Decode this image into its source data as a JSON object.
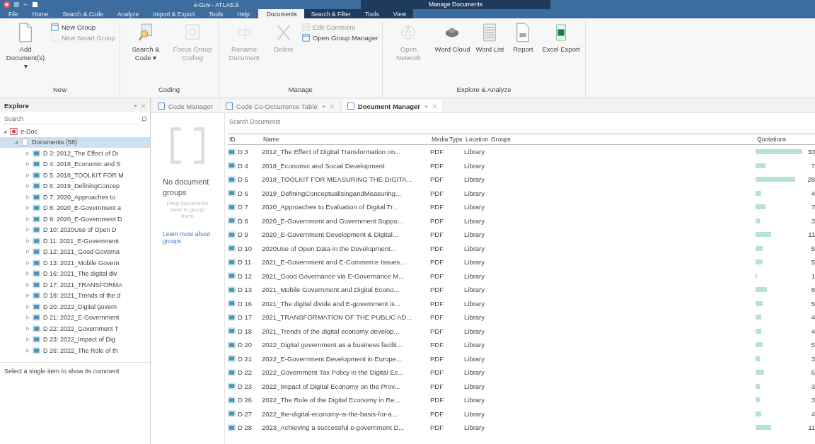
{
  "window": {
    "title": "e-Gov - ATLAS.ti"
  },
  "ribbon": {
    "tabs": [
      {
        "label": "File",
        "selected": false
      },
      {
        "label": "Home",
        "selected": false
      },
      {
        "label": "Search & Code",
        "selected": false
      },
      {
        "label": "Analyze",
        "selected": false
      },
      {
        "label": "Import & Export",
        "selected": false
      },
      {
        "label": "Tools",
        "selected": false
      },
      {
        "label": "Help",
        "selected": false
      }
    ],
    "context": {
      "title": "Manage Documents",
      "tabs": [
        {
          "label": "Documents",
          "selected": true
        },
        {
          "label": "Search & Filter",
          "selected": false
        },
        {
          "label": "Tools",
          "selected": false
        },
        {
          "label": "View",
          "selected": false
        }
      ]
    },
    "groups": [
      {
        "label": "New",
        "items": [
          {
            "kind": "large",
            "label": "Add Document(s) ▾",
            "disabled": false
          },
          {
            "kind": "small",
            "label": "New Group",
            "disabled": false
          },
          {
            "kind": "small",
            "label": "New Smart Group",
            "disabled": true
          }
        ]
      },
      {
        "label": "Coding",
        "items": [
          {
            "kind": "large",
            "label": "Search & Code ▾",
            "disabled": false
          },
          {
            "kind": "large",
            "label": "Focus Group Coding",
            "disabled": true
          }
        ]
      },
      {
        "label": "Manage",
        "items": [
          {
            "kind": "large",
            "label": "Rename Document",
            "disabled": true
          },
          {
            "kind": "large",
            "label": "Delete",
            "disabled": true
          },
          {
            "kind": "small",
            "label": "Edit Comment",
            "disabled": true
          },
          {
            "kind": "small",
            "label": "Open Group Manager",
            "disabled": false
          }
        ]
      },
      {
        "label": "Explore & Analyze",
        "items": [
          {
            "kind": "large",
            "label": "Open Network",
            "disabled": true
          },
          {
            "kind": "large",
            "label": "Word Cloud",
            "disabled": false
          },
          {
            "kind": "large",
            "label": "Word List",
            "disabled": false
          },
          {
            "kind": "large",
            "label": "Report",
            "disabled": false
          },
          {
            "kind": "large",
            "label": "Excel Export",
            "disabled": false
          }
        ]
      }
    ]
  },
  "explorer": {
    "title": "Explore",
    "search": {
      "placeholder": "Search"
    },
    "tree": [
      {
        "label": "e-Doc",
        "expanded": true,
        "selected": false,
        "children": [
          {
            "label": "Documents (58)",
            "expanded": true,
            "selected": true,
            "children": [
              {
                "label": "D 3: 2012_The Effect of Di",
                "expanded": false,
                "selected": false
              },
              {
                "label": "D 4: 2018_Economic and S",
                "expanded": false,
                "selected": false
              },
              {
                "label": "D 5: 2018_TOOLKIT FOR M",
                "expanded": false,
                "selected": false
              },
              {
                "label": "D 6: 2019_DefiningConcep",
                "expanded": false,
                "selected": false
              },
              {
                "label": "D 7: 2020_Approaches to",
                "expanded": false,
                "selected": false
              },
              {
                "label": "D 8: 2020_E-Government a",
                "expanded": false,
                "selected": false
              },
              {
                "label": "D 9: 2020_E-Government D",
                "expanded": false,
                "selected": false
              },
              {
                "label": "D 10: 2020Use of Open D",
                "expanded": false,
                "selected": false
              },
              {
                "label": "D 11: 2021_E-Government",
                "expanded": false,
                "selected": false
              },
              {
                "label": "D 12: 2021_Good Governa",
                "expanded": false,
                "selected": false
              },
              {
                "label": "D 13: 2021_Mobile Govern",
                "expanded": false,
                "selected": false
              },
              {
                "label": "D 16: 2021_The digital div",
                "expanded": false,
                "selected": false
              },
              {
                "label": "D 17: 2021_TRANSFORMA",
                "expanded": false,
                "selected": false
              },
              {
                "label": "D 18: 2021_Trends of the d",
                "expanded": false,
                "selected": false
              },
              {
                "label": "D 20: 2022_Digital govern",
                "expanded": false,
                "selected": false
              },
              {
                "label": "D 21: 2022_E-Government",
                "expanded": false,
                "selected": false
              },
              {
                "label": "D 22: 2022_Government T",
                "expanded": false,
                "selected": false
              },
              {
                "label": "D 23: 2022_Impact of Dig",
                "expanded": false,
                "selected": false
              },
              {
                "label": "D 26: 2022_The Role of th",
                "expanded": false,
                "selected": false
              }
            ]
          }
        ]
      }
    ],
    "comment": "Select a single item to show its comment"
  },
  "panel_tabs": [
    {
      "label": "Code Manager",
      "selected": false,
      "has_controls": false
    },
    {
      "label": "Code Co-Occurrence Table",
      "selected": false,
      "has_controls": true
    },
    {
      "label": "Document Manager",
      "selected": true,
      "has_controls": true
    }
  ],
  "groups_pane": {
    "title": "No document groups",
    "hint": "Drag documents here to group them",
    "link": "Learn more about groups"
  },
  "documents": {
    "search": {
      "placeholder": "Search Documents"
    },
    "columns": [
      "ID",
      "Name",
      "Media Type",
      "Location",
      "Groups",
      "Quotations"
    ],
    "rows": [
      {
        "id": "D 3",
        "name": "2012_The Effect of Digital Transformation on...",
        "media": "PDF",
        "location": "Library",
        "quotations": "33"
      },
      {
        "id": "D 4",
        "name": "2018_Economic and Social Development",
        "media": "PDF",
        "location": "Library",
        "quotations": "7"
      },
      {
        "id": "D 5",
        "name": "2018_TOOLKIT FOR MEASURING THE DIGITA...",
        "media": "PDF",
        "location": "Library",
        "quotations": "28"
      },
      {
        "id": "D 6",
        "name": "2019_DefiningConceptualisingandMeasuring...",
        "media": "PDF",
        "location": "Library",
        "quotations": "4"
      },
      {
        "id": "D 7",
        "name": "2020_Approaches to Evaluation of Digital Tr...",
        "media": "PDF",
        "location": "Library",
        "quotations": "7"
      },
      {
        "id": "D 8",
        "name": "2020_E-Government and Government Suppo...",
        "media": "PDF",
        "location": "Library",
        "quotations": "3"
      },
      {
        "id": "D 9",
        "name": "2020_E-Government Development & Digital...",
        "media": "PDF",
        "location": "Library",
        "quotations": "11"
      },
      {
        "id": "D 10",
        "name": "2020Use of Open Data in the Development...",
        "media": "PDF",
        "location": "Library",
        "quotations": "5"
      },
      {
        "id": "D 11",
        "name": "2021_E-Government and E-Commerce Issues...",
        "media": "PDF",
        "location": "Library",
        "quotations": "5"
      },
      {
        "id": "D 12",
        "name": "2021_Good Governance via E-Governance M...",
        "media": "PDF",
        "location": "Library",
        "quotations": "1"
      },
      {
        "id": "D 13",
        "name": "2021_Mobile Government and Digital Econo...",
        "media": "PDF",
        "location": "Library",
        "quotations": "8"
      },
      {
        "id": "D 16",
        "name": "2021_The digital divide and E-government is...",
        "media": "PDF",
        "location": "Library",
        "quotations": "5"
      },
      {
        "id": "D 17",
        "name": "2021_TRANSFORMATION OF THE PUBLIC AD...",
        "media": "PDF",
        "location": "Library",
        "quotations": "4"
      },
      {
        "id": "D 18",
        "name": "2021_Trends of the digital economy develop...",
        "media": "PDF",
        "location": "Library",
        "quotations": "4"
      },
      {
        "id": "D 20",
        "name": "2022_Digital government as a business facilit...",
        "media": "PDF",
        "location": "Library",
        "quotations": "5"
      },
      {
        "id": "D 21",
        "name": "2022_E-Government Development in Europe...",
        "media": "PDF",
        "location": "Library",
        "quotations": "3"
      },
      {
        "id": "D 22",
        "name": "2022_Government Tax Policy in the Digital Ec...",
        "media": "PDF",
        "location": "Library",
        "quotations": "6"
      },
      {
        "id": "D 23",
        "name": "2022_Impact of Digital Economy on the Prov...",
        "media": "PDF",
        "location": "Library",
        "quotations": "3"
      },
      {
        "id": "D 26",
        "name": "2022_The Role of the Digital Economy in Re...",
        "media": "PDF",
        "location": "Library",
        "quotations": "3"
      },
      {
        "id": "D 27",
        "name": "2022_the-digital-economy-is-the-basis-for-a...",
        "media": "PDF",
        "location": "Library",
        "quotations": "4"
      },
      {
        "id": "D 28",
        "name": "2023_Achieving a successful e-government D...",
        "media": "PDF",
        "location": "Library",
        "quotations": "11"
      }
    ]
  }
}
